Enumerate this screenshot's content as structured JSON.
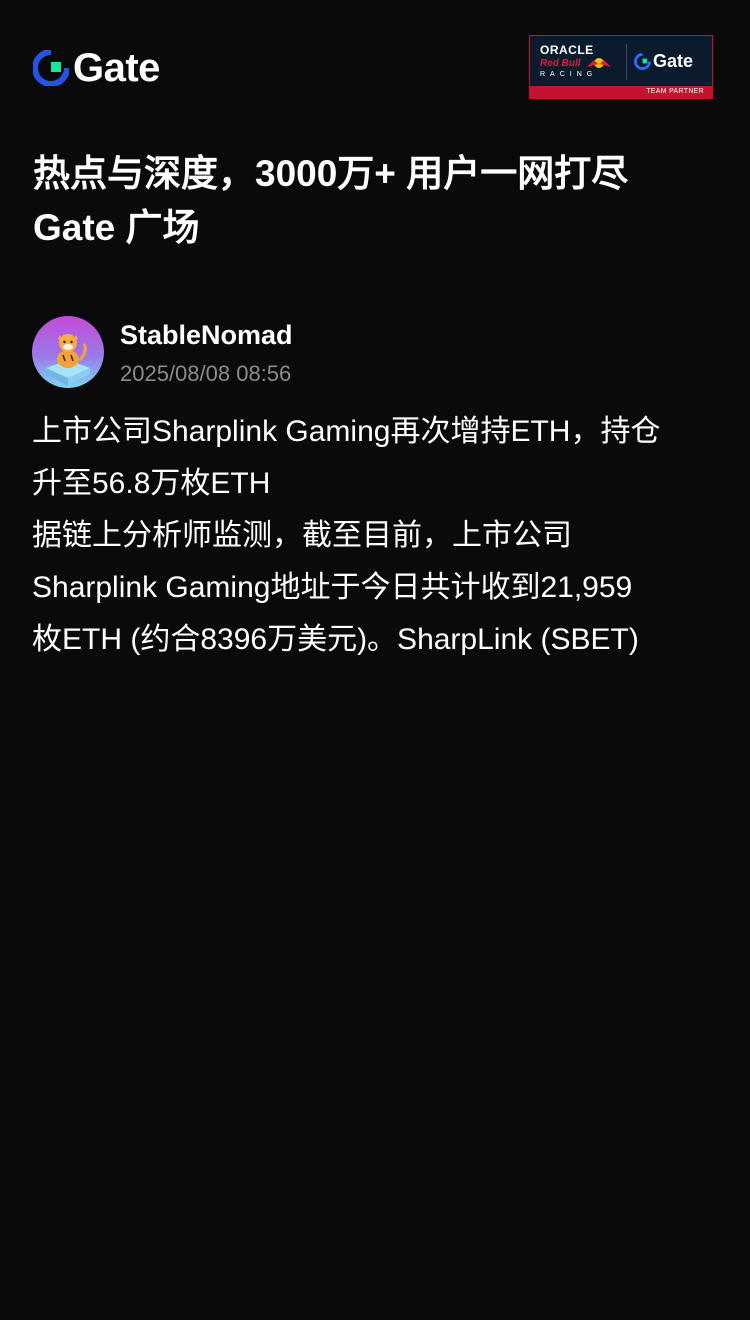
{
  "header": {
    "logo_text": "Gate",
    "brand_color": "#2354e6",
    "accent_color": "#17e6a1",
    "partner": {
      "oracle": "ORACLE",
      "redbull": "Red Bull",
      "racing": "RACING",
      "gate_text": "Gate",
      "team_partner": "TEAM PARTNER"
    }
  },
  "hero": {
    "title_line1": "热点与深度，3000万+ 用户一网打尽",
    "title_line2": "Gate 广场"
  },
  "post": {
    "author": "StableNomad",
    "timestamp": "2025/08/08 08:56",
    "avatar_icon": "tiger-avatar-icon",
    "body_lines": [
      "上市公司Sharplink Gaming再次增持ETH，持仓",
      "升至56.8万枚ETH",
      "据链上分析师监测，截至目前，上市公司",
      "Sharplink Gaming地址于今日共计收到21,959",
      "枚ETH (约合8396万美元)。SharpLink (SBET)"
    ]
  }
}
